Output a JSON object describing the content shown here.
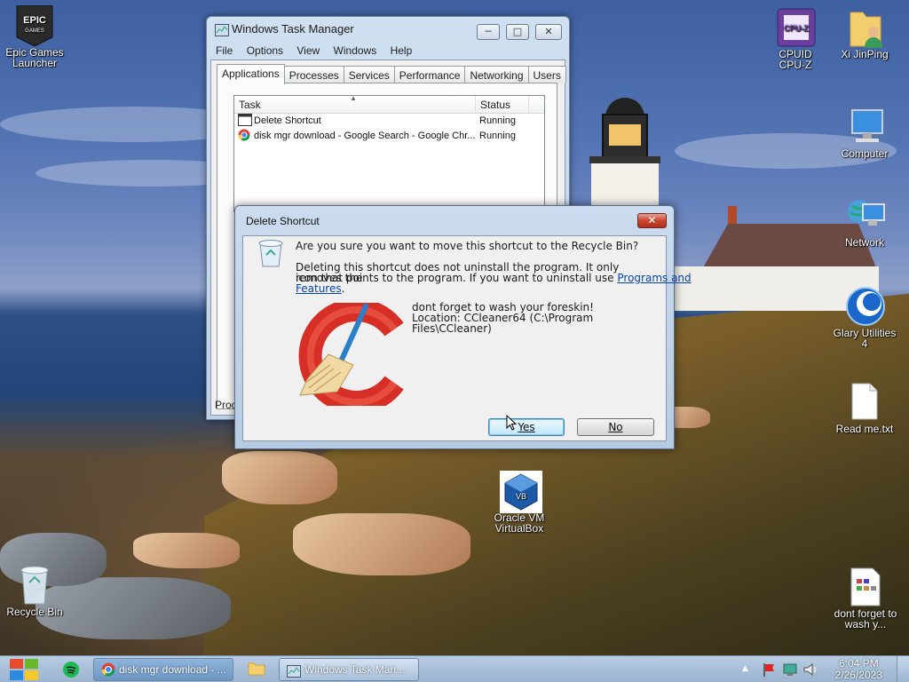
{
  "desktop": {
    "icons": [
      {
        "label": "Epic Games Launcher",
        "icon": "epic-games-icon"
      },
      {
        "label": "CPUID CPU-Z",
        "icon": "cpuz-icon"
      },
      {
        "label": "Xi JinPing",
        "icon": "user-folder-icon"
      },
      {
        "label": "Computer",
        "icon": "computer-icon"
      },
      {
        "label": "Network",
        "icon": "network-icon"
      },
      {
        "label": "Glary Utilities 4",
        "icon": "glary-utilities-icon"
      },
      {
        "label": "Read me.txt",
        "icon": "text-file-icon"
      },
      {
        "label": "Oracle VM VirtualBox",
        "icon": "virtualbox-icon"
      },
      {
        "label": "Recycle Bin",
        "icon": "recycle-bin-icon"
      },
      {
        "label": "dont forget to wash y...",
        "icon": "document-icon"
      }
    ]
  },
  "task_manager": {
    "title": "Windows Task Manager",
    "menu": [
      "File",
      "Options",
      "View",
      "Windows",
      "Help"
    ],
    "tabs": [
      "Applications",
      "Processes",
      "Services",
      "Performance",
      "Networking",
      "Users"
    ],
    "active_tab": "Applications",
    "columns": {
      "task": "Task",
      "status": "Status"
    },
    "rows": [
      {
        "task": "Delete Shortcut",
        "status": "Running"
      },
      {
        "task": "disk mgr download - Google Search - Google Chr...",
        "status": "Running"
      }
    ],
    "footer_partial": "Proc"
  },
  "dialog": {
    "title": "Delete Shortcut",
    "question": "Are you sure you want to move this shortcut to the Recycle Bin?",
    "info_line1": "Deleting this shortcut does not uninstall the program. It only removes the",
    "info_line2_prefix": "icon that points to the program. If you want to uninstall use ",
    "info_link_part1": "Programs and",
    "info_link_part2": "Features",
    "info_suffix": ".",
    "item_name": "dont forget to wash your foreskin!",
    "item_location": "Location: CCleaner64 (C:\\Program Files\\CCleaner)",
    "yes_label": "Yes",
    "no_label": "No"
  },
  "taskbar": {
    "buttons": [
      {
        "label": "disk mgr download - ...",
        "icon": "chrome-icon"
      },
      {
        "label": "Windows Task Man...",
        "icon": "task-manager-icon"
      }
    ],
    "time": "6:04 PM",
    "date": "2/26/2023"
  },
  "colors": {
    "link": "#0645ad",
    "close_button": "#c9452f",
    "taskbar": "#a8bfd8"
  }
}
